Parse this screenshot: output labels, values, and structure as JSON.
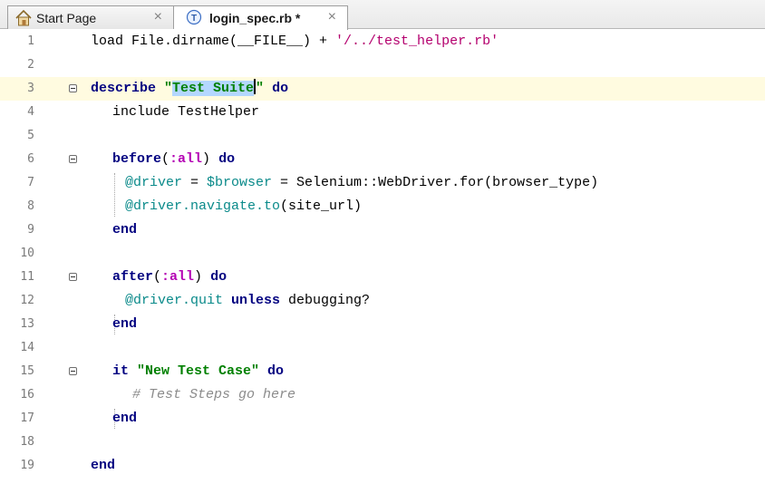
{
  "tabs": [
    {
      "label": "Start Page",
      "icon": "home-icon",
      "active": false,
      "close": "×"
    },
    {
      "label": "login_spec.rb *",
      "icon": "test-file-icon",
      "icon_letter": "T",
      "active": true,
      "close": "×"
    }
  ],
  "editor": {
    "current_line": 3,
    "line_numbers": [
      "1",
      "2",
      "3",
      "4",
      "5",
      "6",
      "7",
      "8",
      "9",
      "10",
      "11",
      "12",
      "13",
      "14",
      "15",
      "16",
      "17",
      "18",
      "19"
    ],
    "lines": {
      "l1": {
        "a": "load File.dirname(__FILE__) + ",
        "b": "'/../test_helper.rb'"
      },
      "l3": {
        "kw": "describe",
        "q1": " \"",
        "sel": "Test Suite",
        "q2": "\"",
        "kw2": " do"
      },
      "l4": {
        "a": "include TestHelper"
      },
      "l6": {
        "kw": "before",
        "p1": "(",
        "sym": ":all",
        "p2": ")",
        "kw2": " do"
      },
      "l7": {
        "ivar": "@driver",
        "eq1": " = ",
        "gvar": "$browser",
        "rest": " = Selenium::WebDriver.for(browser_type)"
      },
      "l8": {
        "ivar": "@driver",
        "meth": ".navigate.to",
        "rest": "(site_url)"
      },
      "l9": {
        "kw": "end"
      },
      "l11": {
        "kw": "after",
        "p1": "(",
        "sym": ":all",
        "p2": ")",
        "kw2": " do"
      },
      "l12": {
        "ivar": "@driver",
        "meth": ".quit",
        "kw": " unless",
        "rest": " debugging?"
      },
      "l13": {
        "kw": "end"
      },
      "l15": {
        "kw": "it",
        "str": " \"New Test Case\"",
        "kw2": " do"
      },
      "l16": {
        "cmt": "# Test Steps go here"
      },
      "l17": {
        "kw": "end"
      },
      "l19": {
        "kw": "end"
      }
    }
  }
}
